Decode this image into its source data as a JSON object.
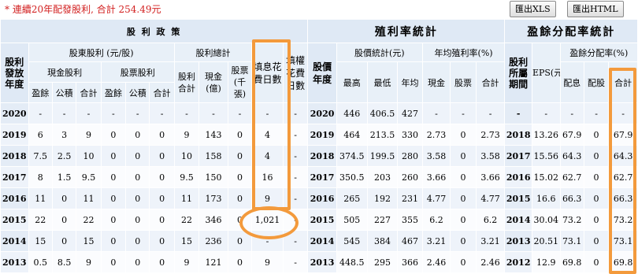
{
  "note": "* 連續20年配發股利, 合計 254.49元",
  "buttons": {
    "xls": "匯出XLS",
    "html": "匯出HTML"
  },
  "groups": {
    "dividend_policy": "股 利 政 策",
    "yield_stats": "殖利率統計",
    "payout_stats": "盈餘分配率統計"
  },
  "headers": {
    "year_col": "股利發放年度",
    "shareholder_div": "股東股利 (元/股)",
    "div_total": "股利總計",
    "fill_div_days": "填息花費日數",
    "fill_right_days": "填權花費日數",
    "cash_div": "現金股利",
    "stock_div": "股票股利",
    "div_sum": "股利合計",
    "cash_amount": "現金(億)",
    "stock_amount": "股票(千張)",
    "earnings": "盈餘",
    "reserve": "公積",
    "subtotal": "合計",
    "price_year": "股價年度",
    "price_stats": "股價統計(元)",
    "avg_yield": "年均殖利率(%)",
    "high": "最高",
    "low": "最低",
    "avg": "年均",
    "cash": "現金",
    "stock": "股票",
    "total": "合計",
    "period": "股利所屬期間",
    "eps": "EPS(元)",
    "payout_ratio": "盈餘分配率(%)",
    "payout_cash": "配息",
    "payout_stock": "配股",
    "payout_total": "合計"
  },
  "rows": [
    [
      "2020",
      "-",
      "-",
      "-",
      "-",
      "-",
      "-",
      "-",
      "-",
      "-",
      "-",
      "-",
      "2020",
      "446",
      "406.5",
      "427",
      "-",
      "-",
      "-",
      "-",
      "-",
      "-",
      "-",
      "-"
    ],
    [
      "2019",
      "6",
      "3",
      "9",
      "0",
      "0",
      "0",
      "9",
      "143",
      "0",
      "4",
      "-",
      "2019",
      "464",
      "213.5",
      "330",
      "2.73",
      "0",
      "2.73",
      "2018",
      "13.26",
      "67.9",
      "0",
      "67.9"
    ],
    [
      "2018",
      "7.5",
      "2.5",
      "10",
      "0",
      "0",
      "0",
      "10",
      "158",
      "0",
      "4",
      "-",
      "2018",
      "374.5",
      "199.5",
      "280",
      "3.58",
      "0",
      "3.58",
      "2017",
      "15.56",
      "64.3",
      "0",
      "64.3"
    ],
    [
      "2017",
      "8",
      "1.5",
      "9.5",
      "0",
      "0",
      "0",
      "9.5",
      "150",
      "0",
      "16",
      "-",
      "2017",
      "350.5",
      "203",
      "260",
      "3.66",
      "0",
      "3.66",
      "2016",
      "15.02",
      "62.7",
      "0",
      "62.7"
    ],
    [
      "2016",
      "11",
      "0",
      "11",
      "0",
      "0",
      "0",
      "11",
      "173",
      "0",
      "9",
      "-",
      "2016",
      "265",
      "192",
      "231",
      "4.77",
      "0",
      "4.77",
      "2015",
      "16.6",
      "66.3",
      "0",
      "66.3"
    ],
    [
      "2015",
      "22",
      "0",
      "22",
      "0",
      "0",
      "0",
      "22",
      "346",
      "0",
      "1,021",
      "-",
      "2015",
      "505",
      "227",
      "355",
      "6.2",
      "0",
      "6.2",
      "2014",
      "30.04",
      "73.2",
      "0",
      "73.2"
    ],
    [
      "2014",
      "15",
      "0",
      "15",
      "0",
      "0",
      "0",
      "15",
      "236",
      "0",
      "-",
      "-",
      "2014",
      "545",
      "384",
      "467",
      "3.21",
      "0",
      "3.21",
      "2013",
      "20.51",
      "73.1",
      "0",
      "73.1"
    ],
    [
      "2013",
      "0.5",
      "8.5",
      "9",
      "0",
      "0",
      "0",
      "9",
      "121",
      "0",
      "9",
      "-",
      "2013",
      "448.5",
      "295",
      "366",
      "2.46",
      "0",
      "2.46",
      "2012",
      "12.9",
      "69.8",
      "0",
      "69.8"
    ]
  ]
}
